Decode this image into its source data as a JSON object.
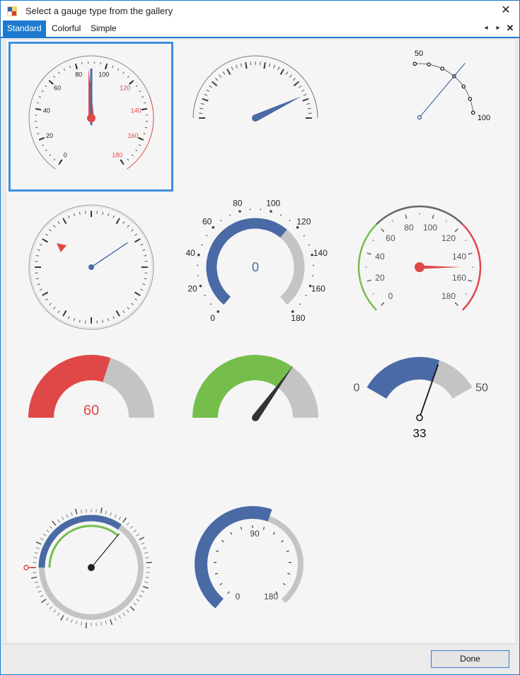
{
  "window": {
    "title": "Select a gauge type from the gallery"
  },
  "tabs": [
    {
      "label": "Standard",
      "active": true
    },
    {
      "label": "Colorful",
      "active": false
    },
    {
      "label": "Simple",
      "active": false
    }
  ],
  "nav_icons": [
    "scroll-left-icon",
    "scroll-right-icon",
    "close-tab-icon"
  ],
  "gallery": {
    "selected_index": 0,
    "gauges": [
      {
        "id": "standard-1",
        "labels": [
          "0",
          "20",
          "40",
          "60",
          "80",
          "100",
          "120",
          "140",
          "160",
          "180"
        ],
        "value": 88
      },
      {
        "id": "standard-2",
        "value": 0.86
      },
      {
        "id": "standard-3",
        "labels": [
          "50",
          "100"
        ],
        "value": 75
      },
      {
        "id": "standard-4",
        "value": 0.2
      },
      {
        "id": "standard-5",
        "labels": [
          "0",
          "20",
          "40",
          "60",
          "80",
          "100",
          "120",
          "140",
          "160",
          "180"
        ],
        "center_value": "0"
      },
      {
        "id": "standard-6",
        "labels": [
          "0",
          "20",
          "40",
          "60",
          "80",
          "100",
          "120",
          "140",
          "160",
          "180"
        ],
        "value": 150
      },
      {
        "id": "standard-7",
        "center_value": "60",
        "value": 60
      },
      {
        "id": "standard-8",
        "value": 0.7
      },
      {
        "id": "standard-9",
        "min_label": "0",
        "max_label": "50",
        "center_value": "33",
        "value": 33
      },
      {
        "id": "standard-10",
        "value": 0.35
      },
      {
        "id": "standard-11",
        "labels": [
          "0",
          "90",
          "180"
        ],
        "value": 0.57
      }
    ]
  },
  "colors": {
    "accent": "#1e7ad0",
    "blue": "#4a6aa5",
    "red": "#e04848",
    "green": "#76be4c",
    "gray": "#c4c4c4",
    "dark": "#333333"
  },
  "footer": {
    "done_label": "Done"
  }
}
